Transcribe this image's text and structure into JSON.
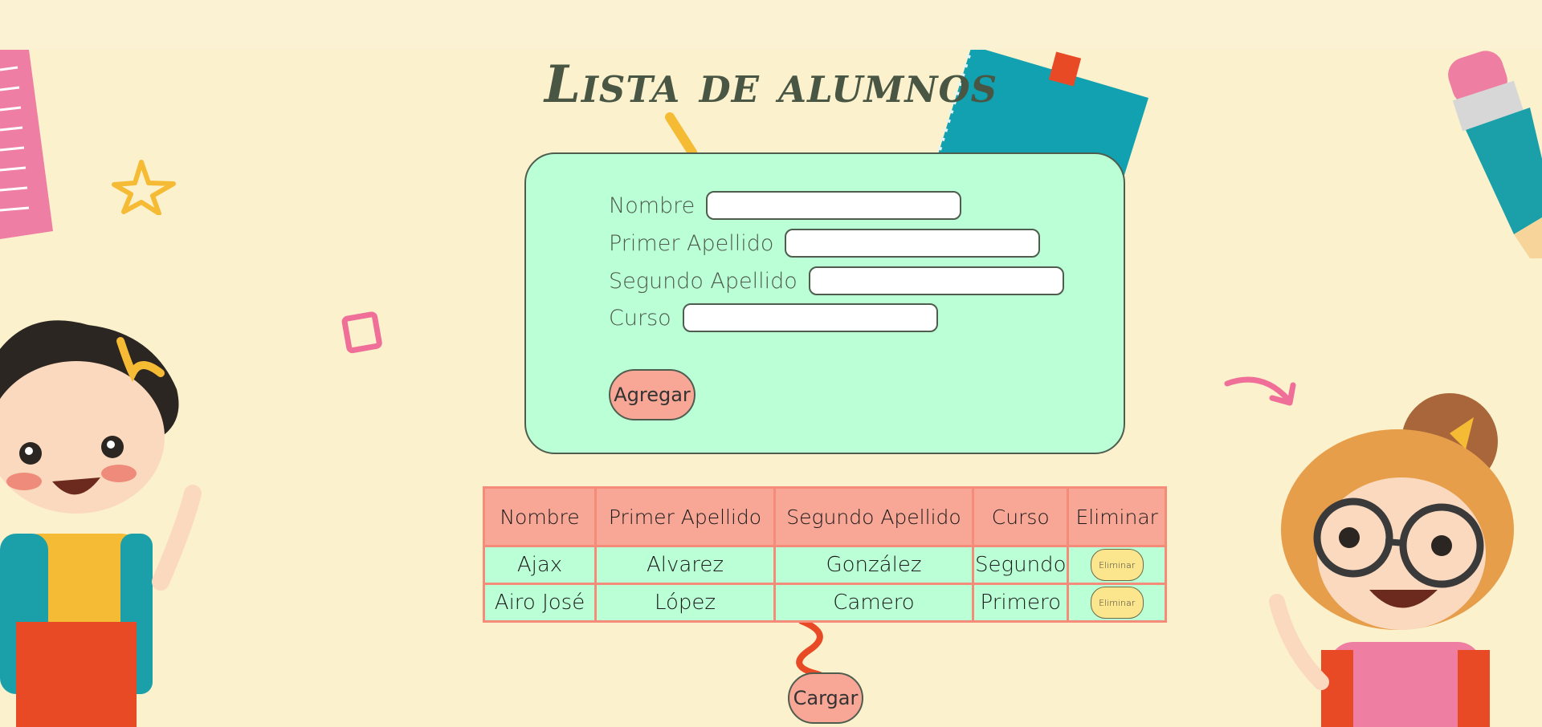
{
  "page": {
    "title": "Lista de alumnos"
  },
  "form": {
    "fields": [
      {
        "label": "Nombre",
        "value": ""
      },
      {
        "label": "Primer Apellido",
        "value": ""
      },
      {
        "label": "Segundo Apellido",
        "value": ""
      },
      {
        "label": "Curso",
        "value": ""
      }
    ],
    "add_label": "Agregar"
  },
  "table": {
    "headers": [
      "Nombre",
      "Primer Apellido",
      "Segundo Apellido",
      "Curso",
      "Eliminar"
    ],
    "rows": [
      {
        "nombre": "Ajax",
        "primer_apellido": "Alvarez",
        "segundo_apellido": "González",
        "curso": "Segundo",
        "delete_label": "Eliminar"
      },
      {
        "nombre": "Airo José",
        "primer_apellido": "López",
        "segundo_apellido": "Camero",
        "curso": "Primero",
        "delete_label": "Eliminar"
      }
    ]
  },
  "load_label": "Cargar",
  "colors": {
    "background": "#fbf1cc",
    "form_background": "#baffd5",
    "table_header": "#f8a796",
    "table_border": "#f58c7a",
    "delete_button": "#fbe58d",
    "title_color": "#495644"
  },
  "decorations": [
    "ruler-illustration",
    "star-icon",
    "square-icon",
    "notebook-illustration",
    "pencil-illustration",
    "arrow-icon",
    "boy-illustration",
    "girl-illustration",
    "squiggle-icon"
  ]
}
